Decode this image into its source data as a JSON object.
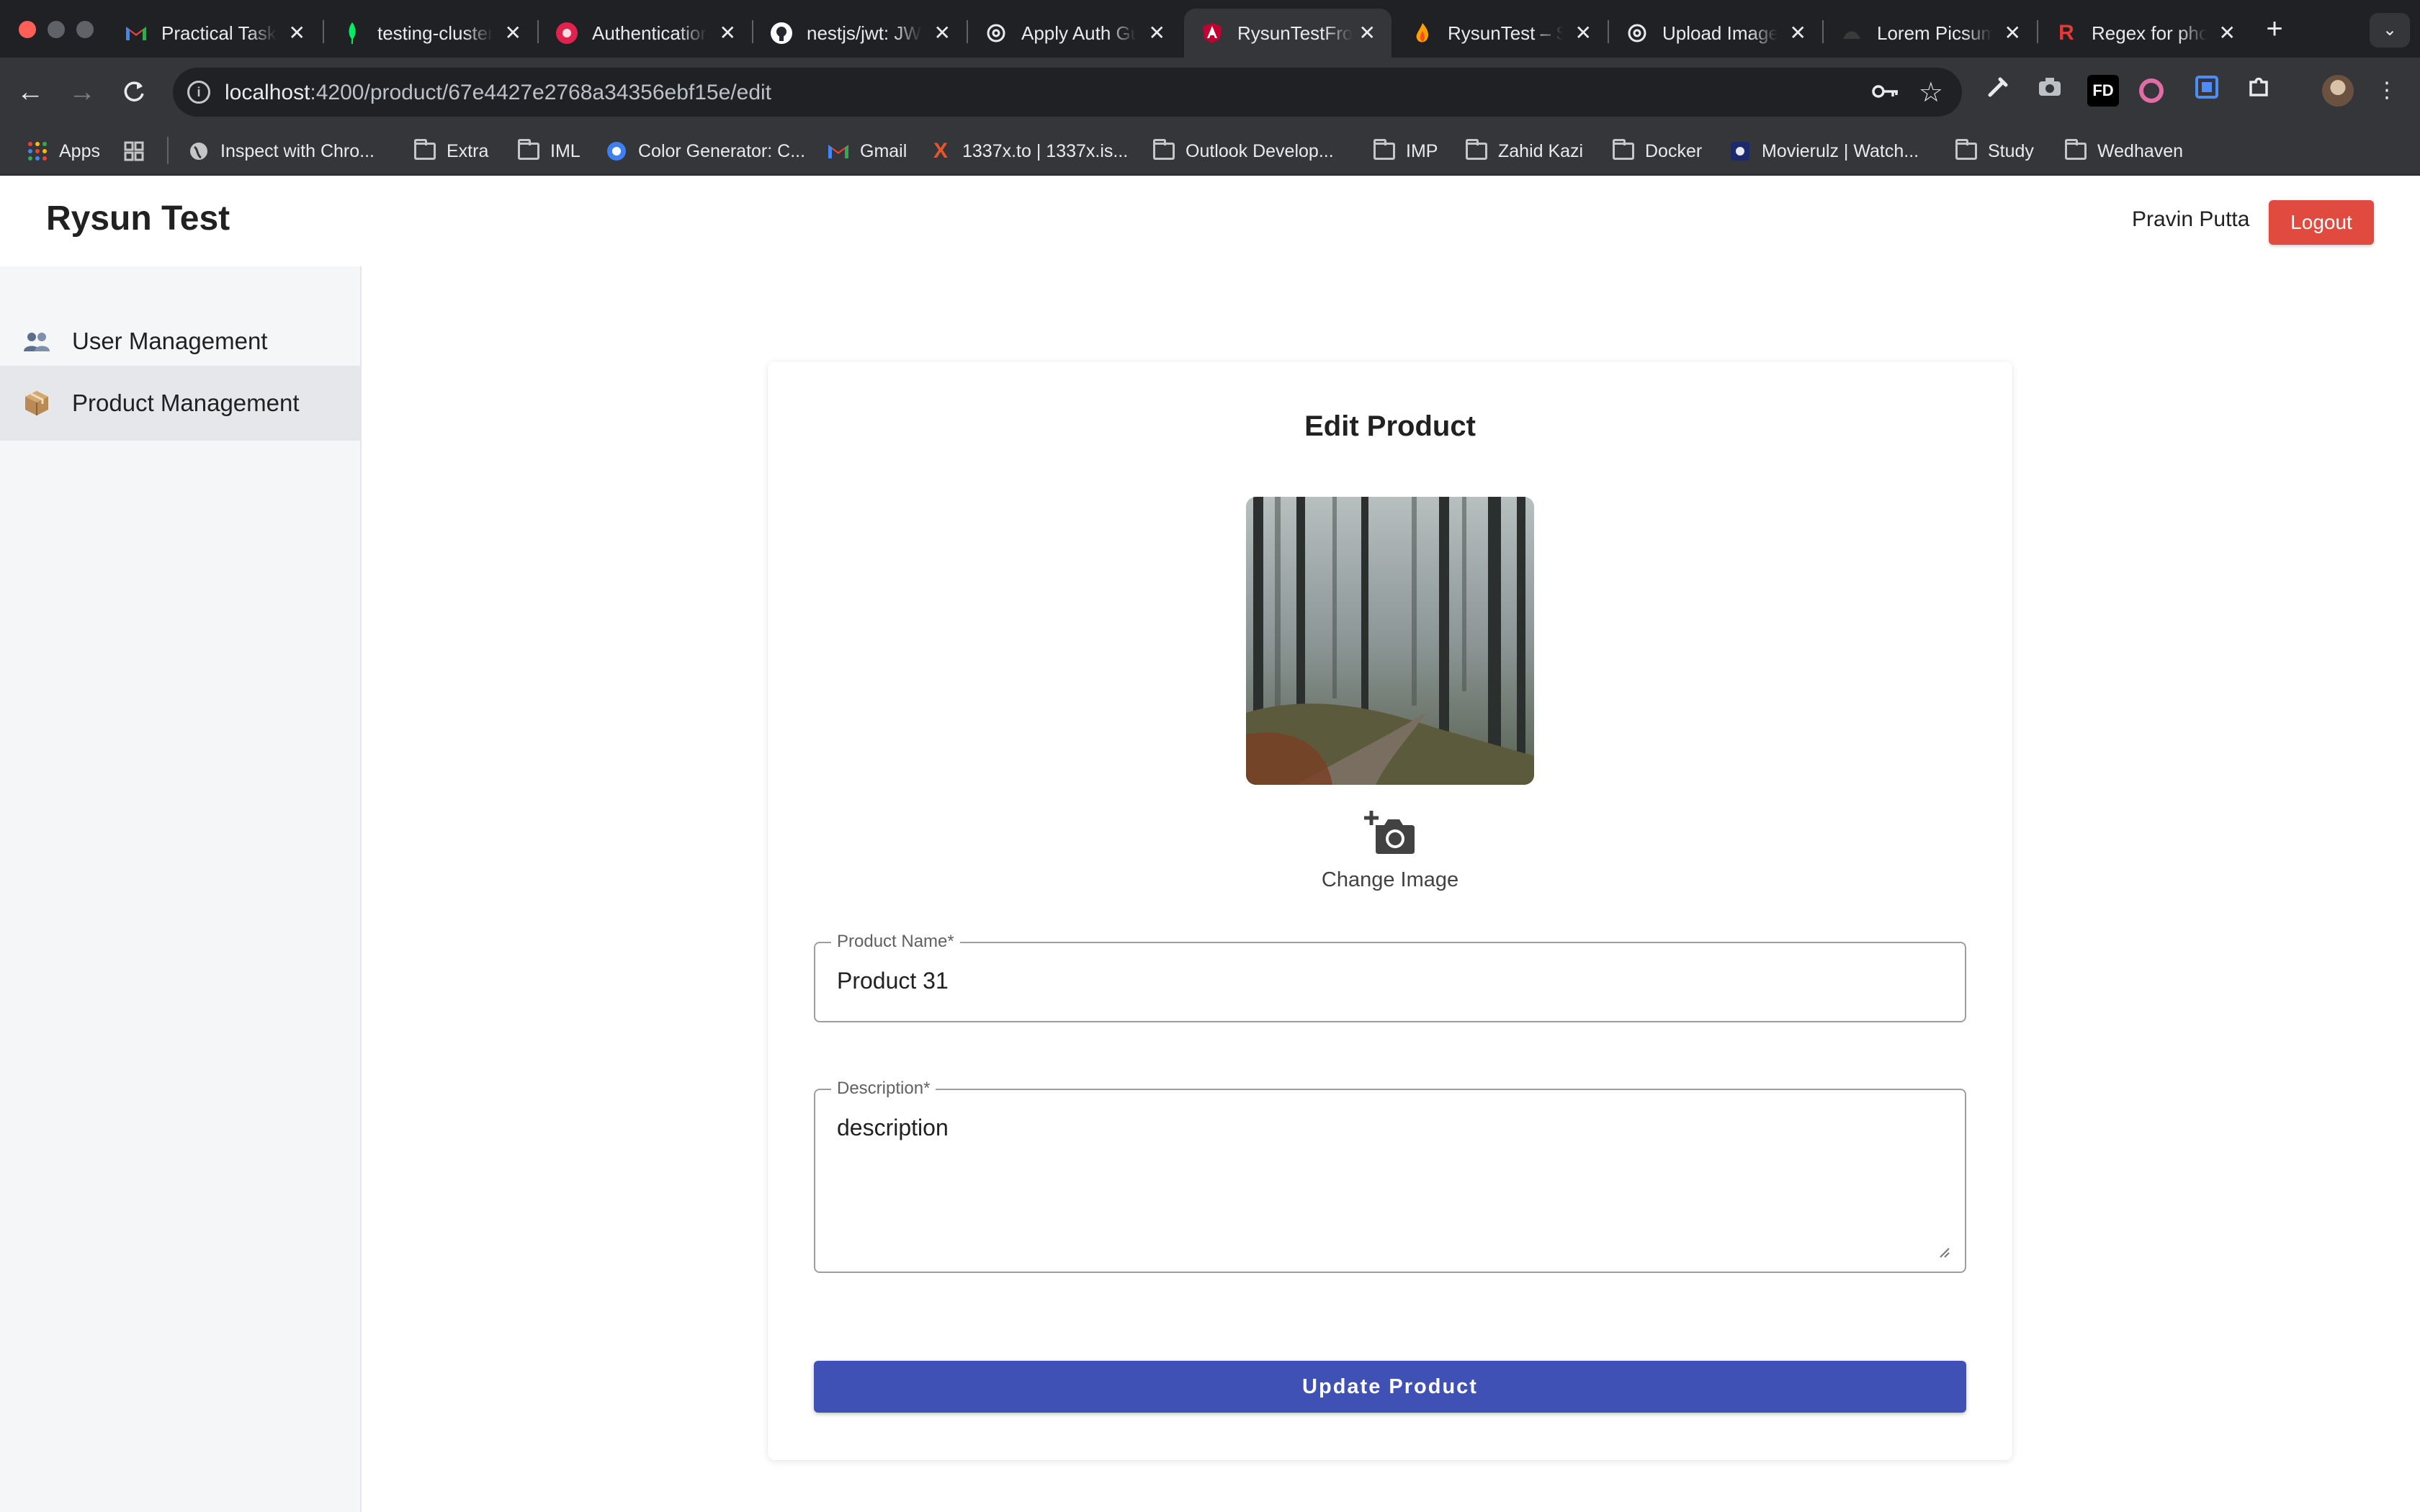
{
  "browser": {
    "tabs": [
      {
        "title": "Practical Task",
        "icon": "gmail-icon",
        "color": "#ea4335"
      },
      {
        "title": "testing-cluster",
        "icon": "mongodb-leaf-icon",
        "color": "#00ed64"
      },
      {
        "title": "Authentication",
        "icon": "nestjs-icon",
        "color": "#e0234e"
      },
      {
        "title": "nestjs/jwt: JWT",
        "icon": "github-icon",
        "color": "#ffffff"
      },
      {
        "title": "Apply Auth Guard",
        "icon": "chatgpt-icon",
        "color": "#ffffff"
      },
      {
        "title": "RysunTestFrontend",
        "icon": "angular-icon",
        "color": "#c3002f"
      },
      {
        "title": "RysunTest – Storage",
        "icon": "firebase-icon",
        "color": "#ffa000"
      },
      {
        "title": "Upload Image",
        "icon": "chatgpt-icon",
        "color": "#ffffff"
      },
      {
        "title": "Lorem Picsum",
        "icon": "picsum-icon",
        "color": "#333333"
      },
      {
        "title": "Regex for phone",
        "icon": "regexr-icon",
        "color": "#e53935"
      }
    ],
    "active_tab_index": 5,
    "url_host": "localhost",
    "url_path": ":4200/product/67e4427e2768a34356ebf15e/edit",
    "bookmarks": [
      {
        "label": "Apps",
        "icon": "apps-grid-icon"
      },
      {
        "label": "Inspect with Chro...",
        "icon": "globe-icon"
      },
      {
        "label": "Extra",
        "icon": "folder-icon"
      },
      {
        "label": "IML",
        "icon": "folder-icon"
      },
      {
        "label": "Color Generator: C...",
        "icon": "color-generator-icon"
      },
      {
        "label": "Gmail",
        "icon": "gmail-icon"
      },
      {
        "label": "1337x.to | 1337x.is...",
        "icon": "x-icon"
      },
      {
        "label": "Outlook Develop...",
        "icon": "folder-icon"
      },
      {
        "label": "IMP",
        "icon": "folder-icon"
      },
      {
        "label": "Zahid Kazi",
        "icon": "folder-icon"
      },
      {
        "label": "Docker",
        "icon": "folder-icon"
      },
      {
        "label": "Movierulz | Watch...",
        "icon": "movierulz-icon"
      },
      {
        "label": "Study",
        "icon": "folder-icon"
      },
      {
        "label": "Wedhaven",
        "icon": "folder-icon"
      }
    ]
  },
  "header": {
    "brand": "Rysun Test",
    "user_name": "Pravin Putta",
    "logout_label": "Logout"
  },
  "sidebar": {
    "items": [
      {
        "label": "User Management",
        "icon": "users-icon",
        "active": false
      },
      {
        "label": "Product Management",
        "icon": "package-icon",
        "active": true
      }
    ]
  },
  "form": {
    "title": "Edit Product",
    "image_alt": "forest-path-photo",
    "change_image_label": "Change Image",
    "name_label": "Product Name*",
    "name_value": "Product 31",
    "description_label": "Description*",
    "description_value": "description",
    "submit_label": "Update Product"
  },
  "colors": {
    "primary": "#3f51b5",
    "danger": "#e04a3f",
    "sidebar_active": "#e6e7eb"
  }
}
